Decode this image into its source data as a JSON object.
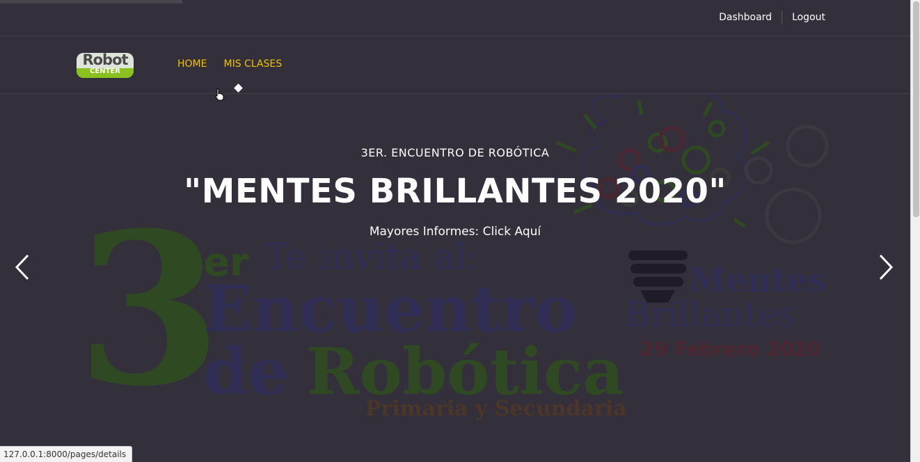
{
  "topbar": {
    "dashboard_label": "Dashboard",
    "logout_label": "Logout"
  },
  "logo": {
    "line1": "Robot",
    "line2": "CENTER",
    "colors": {
      "green": "#8ac11f",
      "body": "#dfe4da"
    }
  },
  "nav": {
    "items": [
      {
        "label": "HOME"
      },
      {
        "label": "MIS CLASES"
      }
    ],
    "accent": "#f2c300"
  },
  "hero": {
    "kicker": "3ER. ENCUENTRO DE ROBÓTICA",
    "title": "\"MENTES BRILLANTES 2020\"",
    "subtitle": "Mayores Informes: Click Aquí",
    "background_text": {
      "number": "3",
      "ordinal": "er",
      "invita": "Te invita al:",
      "encuentro": "Encuentro",
      "de": "de",
      "robotica": "Robótica",
      "primaria": "Primaria y Secundaria",
      "mentes": "Mentes",
      "brillantes": "Brillantes",
      "fecha": "29 Febrero 2020"
    },
    "prev_icon": "chevron-left-icon",
    "next_icon": "chevron-right-icon"
  },
  "status_bar": {
    "url": "127.0.0.1:8000/pages/details"
  }
}
